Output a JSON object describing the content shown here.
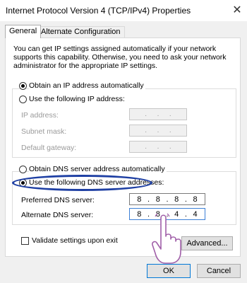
{
  "window": {
    "title": "Internet Protocol Version 4 (TCP/IPv4) Properties",
    "close_glyph": "✕"
  },
  "tabs": [
    {
      "label": "General",
      "active": true
    },
    {
      "label": "Alternate Configuration",
      "active": false
    }
  ],
  "intro_text": "You can get IP settings assigned automatically if your network supports this capability. Otherwise, you need to ask your network administrator for the appropriate IP settings.",
  "ip_section": {
    "auto_label": "Obtain an IP address automatically",
    "manual_label": "Use the following IP address:",
    "selected": "auto",
    "fields": [
      {
        "label": "IP address:",
        "value": [
          ". . ."
        ]
      },
      {
        "label": "Subnet mask:",
        "value": [
          ". . ."
        ]
      },
      {
        "label": "Default gateway:",
        "value": [
          ". . ."
        ]
      }
    ]
  },
  "dns_section": {
    "auto_label": "Obtain DNS server address automatically",
    "manual_label": "Use the following DNS server addresses:",
    "selected": "manual",
    "preferred": {
      "label": "Preferred DNS server:",
      "octets": [
        "8",
        "8",
        "8",
        "8"
      ]
    },
    "alternate": {
      "label": "Alternate DNS server:",
      "octets": [
        "8",
        "8",
        "4",
        "4"
      ]
    }
  },
  "validate_label": "Validate settings upon exit",
  "buttons": {
    "advanced": "Advanced...",
    "ok": "OK",
    "cancel": "Cancel"
  },
  "colors": {
    "highlight": "#1e3fa3",
    "focus": "#3c7fd6",
    "default_button": "#0078d7"
  },
  "icons": {
    "pointer": "hand-pointer-icon"
  }
}
